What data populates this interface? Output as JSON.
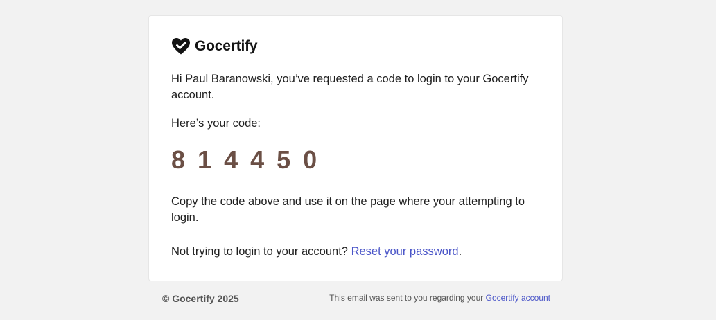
{
  "brand": {
    "name": "Gocertify",
    "logo_icon": "heart-check-icon",
    "colors": {
      "logo": "#141414",
      "code": "#6b4f45",
      "link": "#4a55c8",
      "background": "#f2f2f2"
    }
  },
  "email": {
    "greeting": "Hi Paul Baranowski, you’ve requested a code to login to your Gocertify account.",
    "code_intro": "Here’s your code:",
    "code_digits": [
      "8",
      "1",
      "4",
      "4",
      "5",
      "0"
    ],
    "instructions": "Copy the code above and use it on the page where your attempting to login.",
    "not_trying_prefix": "Not trying to login to your account? ",
    "reset_link": "Reset your password",
    "not_trying_suffix": "."
  },
  "footer": {
    "copyright": "© Gocertify 2025",
    "sent_prefix": "This email was sent to you regarding your ",
    "account_link": "Gocertify account"
  }
}
